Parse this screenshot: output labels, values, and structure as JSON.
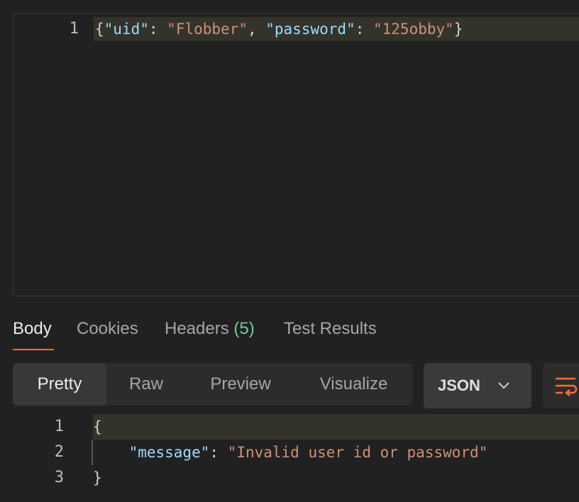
{
  "request_editor": {
    "line_number": "1",
    "json": {
      "open_brace": "{",
      "key1": "\"uid\"",
      "colon1": ": ",
      "val1": "\"Flobber\"",
      "comma": ", ",
      "key2": "\"password\"",
      "colon2": ": ",
      "val2": "\"125obby\"",
      "close_brace": "}"
    }
  },
  "response_tabs": {
    "body": "Body",
    "cookies": "Cookies",
    "headers": "Headers",
    "headers_count": "(5)",
    "test_results": "Test Results"
  },
  "view_modes": {
    "pretty": "Pretty",
    "raw": "Raw",
    "preview": "Preview",
    "visualize": "Visualize"
  },
  "format_select": {
    "value": "JSON"
  },
  "response_body": {
    "lines": [
      {
        "num": "1",
        "text": "{"
      },
      {
        "num": "2",
        "indent": "    ",
        "key": "\"message\"",
        "colon": ": ",
        "value": "\"Invalid user id or password\""
      },
      {
        "num": "3",
        "text": "}"
      }
    ]
  },
  "colors": {
    "accent": "#ff6c37",
    "json_key": "#9cdcfe",
    "json_string": "#ce9178",
    "count_green": "#6fcf97"
  },
  "icons": [
    "chevron-down-icon",
    "wrap-lines-icon"
  ]
}
